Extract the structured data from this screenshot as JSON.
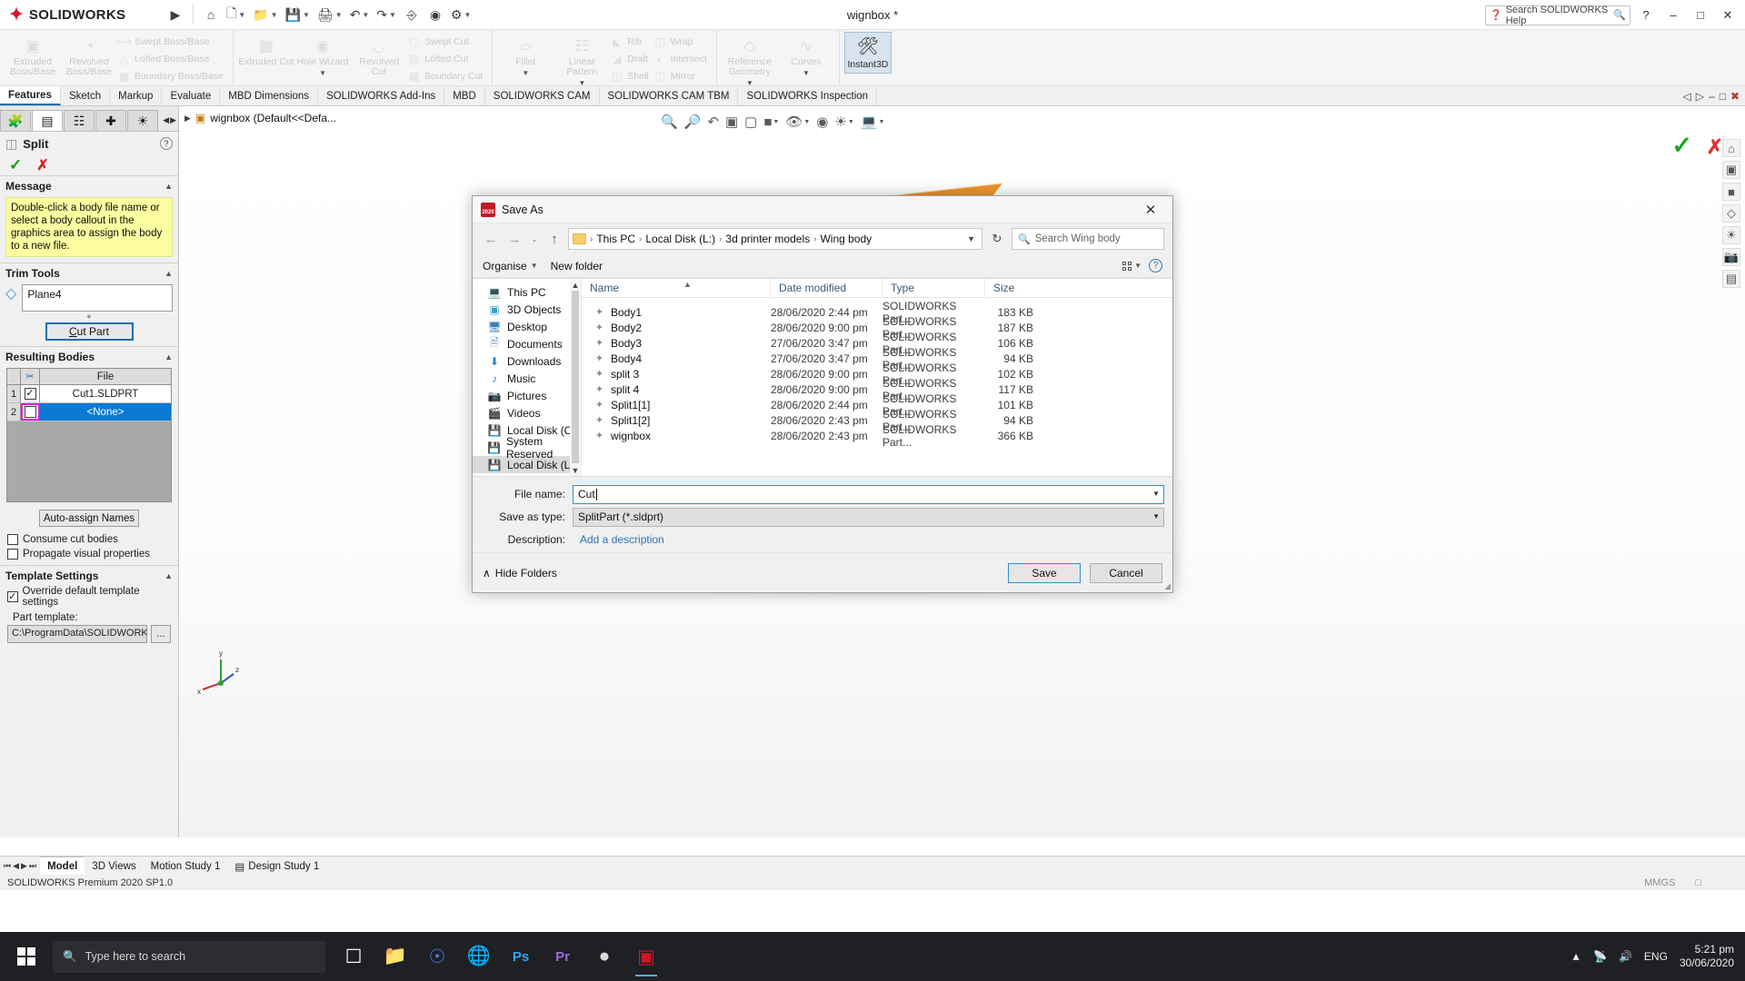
{
  "titlebar": {
    "brand_mark": "DS",
    "brand": "SOLIDWORKS",
    "document_title": "wignbox *",
    "search_placeholder": "Search SOLIDWORKS Help",
    "quick_icons": [
      "play-icon",
      "home-icon",
      "new-doc-icon",
      "open-folder-icon",
      "save-icon",
      "print-icon",
      "undo-icon",
      "redo-icon",
      "select-icon",
      "rebuild-icon",
      "options-gear-icon"
    ],
    "help_label": "?",
    "minimize": "–",
    "maximize": "□",
    "close": "✕"
  },
  "ribbon": {
    "groups": [
      {
        "big": [
          {
            "label": "Extruded Boss/Base",
            "icon": "extrude-icon",
            "enabled": false
          },
          {
            "label": "Revolved Boss/Base",
            "icon": "revolve-icon",
            "enabled": false
          }
        ],
        "small": [
          {
            "label": "Swept Boss/Base",
            "icon": "swept-icon"
          },
          {
            "label": "Lofted Boss/Base",
            "icon": "loft-icon"
          },
          {
            "label": "Boundary Boss/Base",
            "icon": "boundary-icon"
          }
        ]
      },
      {
        "big": [
          {
            "label": "Extruded Cut",
            "icon": "extruded-cut-icon",
            "enabled": false
          },
          {
            "label": "Hole Wizard",
            "icon": "hole-wizard-icon",
            "enabled": false
          },
          {
            "label": "Revolved Cut",
            "icon": "revolved-cut-icon",
            "enabled": false
          }
        ],
        "small": [
          {
            "label": "Swept Cut",
            "icon": "swept-cut-icon"
          },
          {
            "label": "Lofted Cut",
            "icon": "lofted-cut-icon"
          },
          {
            "label": "Boundary Cut",
            "icon": "boundary-cut-icon"
          }
        ]
      },
      {
        "big": [
          {
            "label": "Fillet",
            "icon": "fillet-icon",
            "enabled": false
          },
          {
            "label": "Linear Pattern",
            "icon": "linear-pattern-icon",
            "enabled": false
          }
        ],
        "small": [
          {
            "label": "Rib",
            "icon": "rib-icon"
          },
          {
            "label": "Draft",
            "icon": "draft-icon"
          },
          {
            "label": "Shell",
            "icon": "shell-icon"
          }
        ],
        "small2": [
          {
            "label": "Wrap",
            "icon": "wrap-icon"
          },
          {
            "label": "Intersect",
            "icon": "intersect-icon"
          },
          {
            "label": "Mirror",
            "icon": "mirror-icon"
          }
        ]
      },
      {
        "big": [
          {
            "label": "Reference Geometry",
            "icon": "reference-geometry-icon",
            "enabled": false
          },
          {
            "label": "Curves",
            "icon": "curves-icon",
            "enabled": false
          }
        ],
        "small": []
      }
    ],
    "instant3d": {
      "label": "Instant3D",
      "icon": "instant3d-icon"
    }
  },
  "command_tabs": [
    {
      "label": "Features",
      "active": true
    },
    {
      "label": "Sketch",
      "active": false
    },
    {
      "label": "Markup",
      "active": false
    },
    {
      "label": "Evaluate",
      "active": false
    },
    {
      "label": "MBD Dimensions",
      "active": false
    },
    {
      "label": "SOLIDWORKS Add-Ins",
      "active": false
    },
    {
      "label": "MBD",
      "active": false
    },
    {
      "label": "SOLIDWORKS CAM",
      "active": false
    },
    {
      "label": "SOLIDWORKS CAM TBM",
      "active": false
    },
    {
      "label": "SOLIDWORKS Inspection",
      "active": false
    }
  ],
  "property_manager": {
    "tabs": [
      "feature-manager-tab",
      "property-manager-tab",
      "configuration-manager-tab",
      "dimxpert-tab",
      "display-manager-tab"
    ],
    "title": "Split",
    "title_icon": "split-feature-icon",
    "accept_icon": "checkmark-icon",
    "cancel_icon": "x-icon",
    "help_icon": "?",
    "message": {
      "heading": "Message",
      "text": "Double-click a body file name or select a body callout in the graphics area to assign the body to a new file."
    },
    "trim_tools": {
      "heading": "Trim Tools",
      "value": "Plane4",
      "button": "Cut Part"
    },
    "resulting_bodies": {
      "heading": "Resulting Bodies",
      "columns": [
        "",
        "scissors-icon",
        "File"
      ],
      "rows": [
        {
          "num": "1",
          "checked": true,
          "file": "Cut1.SLDPRT",
          "selected": false
        },
        {
          "num": "2",
          "checked": false,
          "file": "<None>",
          "selected": true
        }
      ],
      "auto_assign": "Auto-assign Names"
    },
    "options": [
      {
        "label": "Consume cut bodies",
        "checked": false
      },
      {
        "label": "Propagate visual properties",
        "checked": false
      }
    ],
    "template_settings": {
      "heading": "Template Settings",
      "override": {
        "label": "Override default template settings",
        "checked": true
      },
      "part_template_label": "Part template:",
      "part_template_value": "C:\\ProgramData\\SOLIDWORKS\\S",
      "browse": "..."
    }
  },
  "graphics": {
    "tree_root": "wignbox  (Default<<Defa...",
    "toolbar_icons": [
      "zoom-to-fit-icon",
      "zoom-area-icon",
      "previous-view-icon",
      "section-view-icon",
      "view-orientation-icon",
      "display-style-icon",
      "hide-show-icon",
      "edit-appearance-icon",
      "apply-scene-icon",
      "view-settings-icon"
    ],
    "confirm_icon": "checkmark-icon",
    "reject_icon": "x-icon",
    "triad_labels": {
      "x": "x",
      "y": "y",
      "z": "z"
    }
  },
  "model_tabs": [
    {
      "label": "Model",
      "active": true
    },
    {
      "label": "3D Views",
      "active": false
    },
    {
      "label": "Motion Study 1",
      "active": false
    },
    {
      "label": "Design Study 1",
      "active": false
    }
  ],
  "statusbar": {
    "left": "SOLIDWORKS Premium 2020 SP1.0",
    "units": "MMGS",
    "extra": "□"
  },
  "taskbar": {
    "search_placeholder": "Type here to search",
    "apps": [
      "task-view-icon",
      "file-explorer-icon",
      "chrome-icon",
      "edge-icon",
      "photoshop-icon",
      "premiere-icon",
      "opera-icon",
      "solidworks-icon"
    ],
    "tray": [
      "show-hidden-icons-chevron",
      "network-icon",
      "volume-icon"
    ],
    "language": "ENG",
    "time": "5:21 pm",
    "date": "30/06/2020"
  },
  "dialog": {
    "title": "Save As",
    "icon": "solidworks-app-icon",
    "close": "✕",
    "nav": {
      "back": "←",
      "forward": "→",
      "recent_dropdown": "⌄",
      "up": "↑",
      "refresh": "↻"
    },
    "breadcrumb": [
      "This PC",
      "Local Disk (L:)",
      "3d printer models",
      "Wing body"
    ],
    "search_placeholder": "Search Wing body",
    "toolbar": {
      "organise": "Organise",
      "new_folder": "New folder",
      "view_icon": "view-layout-icon",
      "help_icon": "?"
    },
    "nav_pane": [
      {
        "label": "This PC",
        "icon": "this-pc-icon",
        "selected": false
      },
      {
        "label": "3D Objects",
        "icon": "3d-objects-icon",
        "selected": false
      },
      {
        "label": "Desktop",
        "icon": "desktop-icon",
        "selected": false
      },
      {
        "label": "Documents",
        "icon": "documents-icon",
        "selected": false
      },
      {
        "label": "Downloads",
        "icon": "downloads-icon",
        "selected": false
      },
      {
        "label": "Music",
        "icon": "music-icon",
        "selected": false
      },
      {
        "label": "Pictures",
        "icon": "pictures-icon",
        "selected": false
      },
      {
        "label": "Videos",
        "icon": "videos-icon",
        "selected": false
      },
      {
        "label": "Local Disk (C:)",
        "icon": "drive-icon",
        "selected": false
      },
      {
        "label": "System Reserved",
        "icon": "drive-icon",
        "selected": false
      },
      {
        "label": "Local Disk (L:)",
        "icon": "drive-icon",
        "selected": true
      }
    ],
    "columns": [
      "Name",
      "Date modified",
      "Type",
      "Size"
    ],
    "files": [
      {
        "name": "Body1",
        "date": "28/06/2020 2:44 pm",
        "type": "SOLIDWORKS Part...",
        "size": "183 KB"
      },
      {
        "name": "Body2",
        "date": "28/06/2020 9:00 pm",
        "type": "SOLIDWORKS Part...",
        "size": "187 KB"
      },
      {
        "name": "Body3",
        "date": "27/06/2020 3:47 pm",
        "type": "SOLIDWORKS Part...",
        "size": "106 KB"
      },
      {
        "name": "Body4",
        "date": "27/06/2020 3:47 pm",
        "type": "SOLIDWORKS Part...",
        "size": "94 KB"
      },
      {
        "name": "split 3",
        "date": "28/06/2020 9:00 pm",
        "type": "SOLIDWORKS Part...",
        "size": "102 KB"
      },
      {
        "name": "split 4",
        "date": "28/06/2020 9:00 pm",
        "type": "SOLIDWORKS Part...",
        "size": "117 KB"
      },
      {
        "name": "Split1[1]",
        "date": "28/06/2020 2:44 pm",
        "type": "SOLIDWORKS Part...",
        "size": "101 KB"
      },
      {
        "name": "Split1[2]",
        "date": "28/06/2020 2:43 pm",
        "type": "SOLIDWORKS Part...",
        "size": "94 KB"
      },
      {
        "name": "wignbox",
        "date": "28/06/2020 2:43 pm",
        "type": "SOLIDWORKS Part...",
        "size": "366 KB"
      }
    ],
    "form": {
      "file_name_label": "File name:",
      "file_name_value": "Cut",
      "save_as_type_label": "Save as type:",
      "save_as_type_value": "SplitPart (*.sldprt)",
      "description_label": "Description:",
      "description_link": "Add a description"
    },
    "footer": {
      "hide_folders": "Hide Folders",
      "hide_folders_chevron": "∧",
      "save": "Save",
      "cancel": "Cancel"
    }
  }
}
